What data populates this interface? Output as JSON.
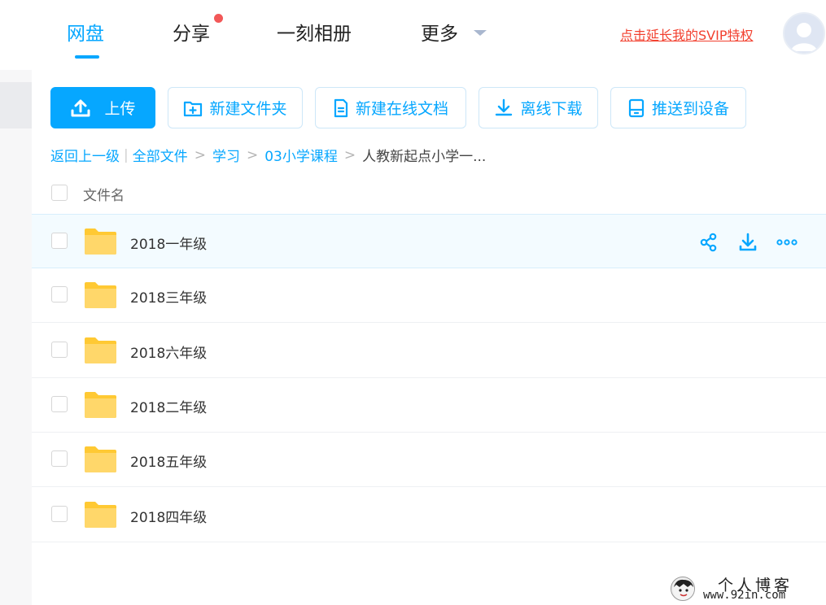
{
  "nav": {
    "items": [
      {
        "label": "网盘",
        "active": true
      },
      {
        "label": "分享",
        "has_dot": true
      },
      {
        "label": "一刻相册"
      },
      {
        "label": "更多",
        "has_caret": true
      }
    ],
    "svip_link": "点击延长我的SVIP特权"
  },
  "toolbar": {
    "upload": "上传",
    "new_folder": "新建文件夹",
    "new_doc": "新建在线文档",
    "offline_download": "离线下载",
    "push_device": "推送到设备"
  },
  "breadcrumb": {
    "back": "返回上一级",
    "items": [
      "全部文件",
      "学习",
      "03小学课程"
    ],
    "current": "人教新起点小学一..."
  },
  "list": {
    "header": "文件名",
    "rows": [
      {
        "name": "2018一年级"
      },
      {
        "name": "2018三年级"
      },
      {
        "name": "2018六年级"
      },
      {
        "name": "2018二年级"
      },
      {
        "name": "2018五年级"
      },
      {
        "name": "2018四年级"
      }
    ]
  },
  "watermark": {
    "title": "个人博客",
    "url": "www.92in.com"
  },
  "colors": {
    "accent": "#06a7ff",
    "svip": "#f2402f",
    "folder": "#ffd155",
    "dot": "#f25858"
  }
}
